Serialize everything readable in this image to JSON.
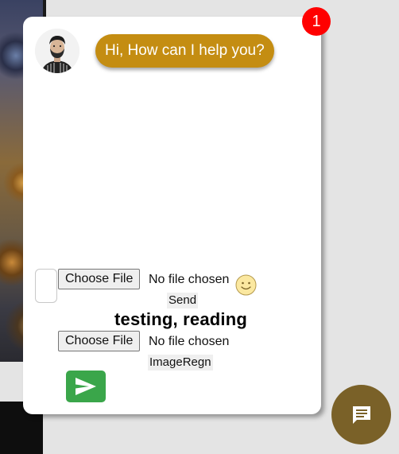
{
  "chat": {
    "unread_count": "1",
    "greeting": "Hi, How can I help you?"
  },
  "composer": {
    "file_input_1": {
      "button_label": "Choose File",
      "status": "No file chosen"
    },
    "send_label": "Send",
    "status_text": "testing, reading",
    "file_input_2": {
      "button_label": "Choose File",
      "status": "No file chosen"
    },
    "image_recognition_label": "ImageRegn"
  },
  "icons": {
    "emoji": "smiley-face-icon",
    "send": "send-arrow-icon",
    "chat": "chat-bubble-icon"
  },
  "colors": {
    "bubble": "#c48d12",
    "badge": "#ff0000",
    "send_button": "#3aa64a",
    "fab": "#7a6128"
  }
}
